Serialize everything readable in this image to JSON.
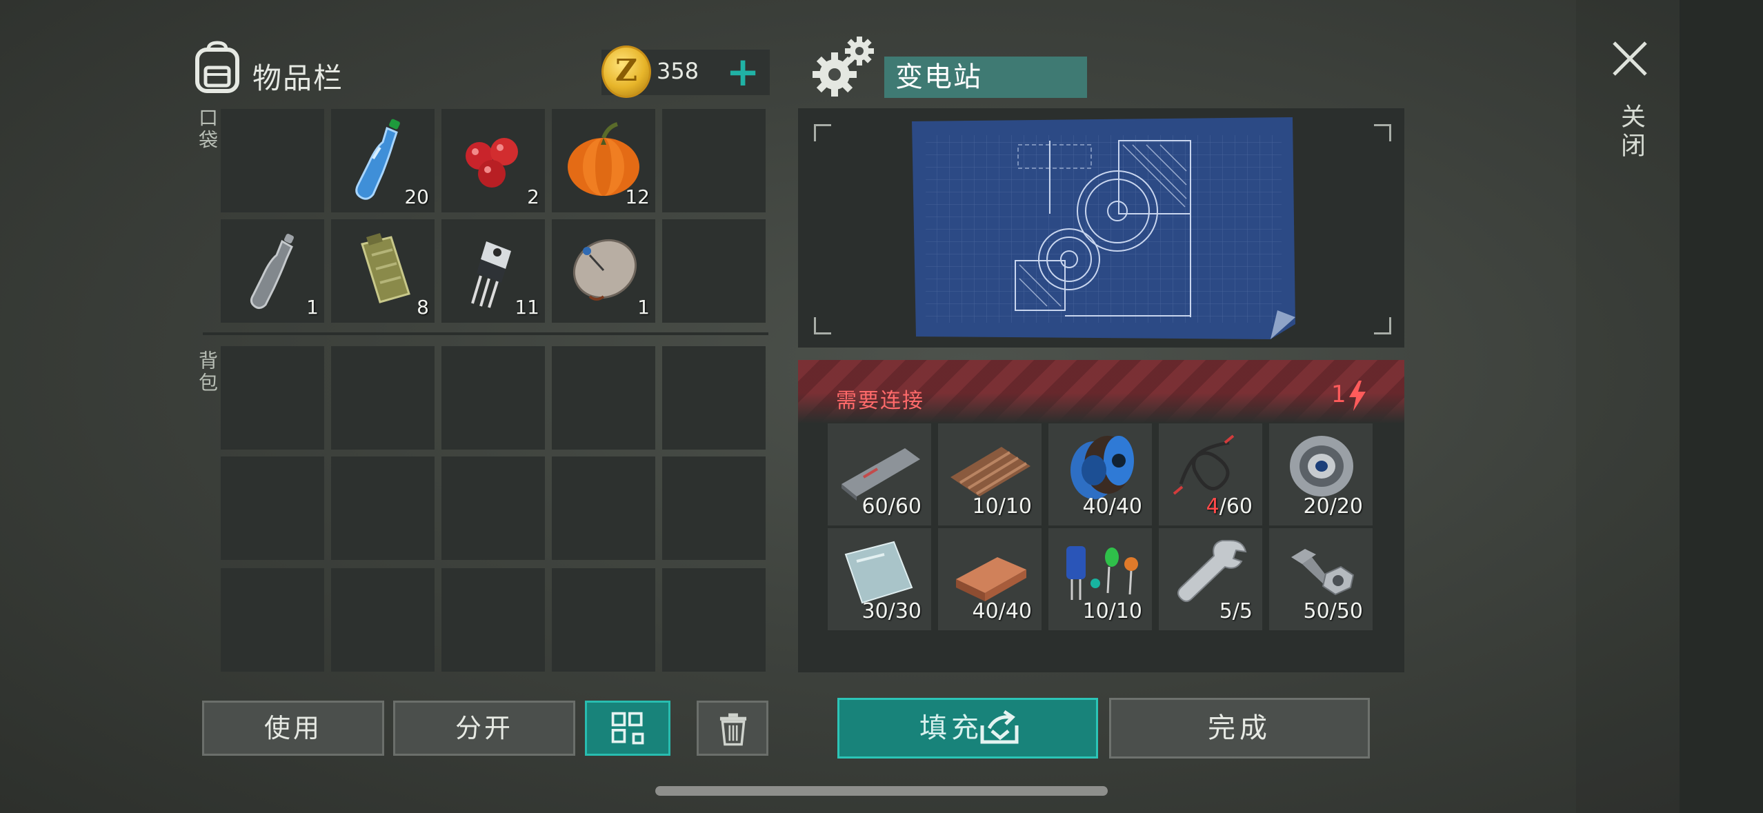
{
  "inventory": {
    "title": "物品栏",
    "coins": "358",
    "coin_symbol": "Z",
    "plus": "+",
    "pocket_label": "口袋",
    "backpack_label": "背包",
    "pocket_slots": [
      {
        "item": "empty",
        "count": ""
      },
      {
        "item": "water-bottle",
        "count": "20"
      },
      {
        "item": "berries",
        "count": "2"
      },
      {
        "item": "pumpkin",
        "count": "12"
      },
      {
        "item": "empty",
        "count": ""
      },
      {
        "item": "empty-bottle",
        "count": "1"
      },
      {
        "item": "jerrycan",
        "count": "8"
      },
      {
        "item": "transistor",
        "count": "11"
      },
      {
        "item": "satellite-dish",
        "count": "1"
      },
      {
        "item": "empty",
        "count": ""
      }
    ],
    "buttons": {
      "use": "使用",
      "split": "分开"
    }
  },
  "station": {
    "name": "变电站",
    "requirement_text": "需要连接",
    "power_value": "1",
    "materials": [
      {
        "item": "metal-bar",
        "have": "60",
        "need": "/60",
        "ok": true
      },
      {
        "item": "corrugated-sheet",
        "have": "10",
        "need": "/10",
        "ok": true
      },
      {
        "item": "wire-spool",
        "have": "40",
        "need": "/40",
        "ok": true
      },
      {
        "item": "cable",
        "have": "4",
        "need": "/60",
        "ok": false
      },
      {
        "item": "bearing",
        "have": "20",
        "need": "/20",
        "ok": true
      },
      {
        "item": "metal-plate",
        "have": "30",
        "need": "/30",
        "ok": true
      },
      {
        "item": "copper-ingot",
        "have": "40",
        "need": "/40",
        "ok": true
      },
      {
        "item": "electronic-components",
        "have": "10",
        "need": "/10",
        "ok": true
      },
      {
        "item": "wrench",
        "have": "5",
        "need": "/5",
        "ok": true
      },
      {
        "item": "bolts",
        "have": "50",
        "need": "/50",
        "ok": true
      }
    ],
    "fill_button": "填充",
    "done_button": "完成"
  },
  "close_label": "关闭",
  "colors": {
    "accent_teal": "#18837a",
    "warning_red": "#ff5b5b",
    "slot_bg": "#2d312f"
  }
}
